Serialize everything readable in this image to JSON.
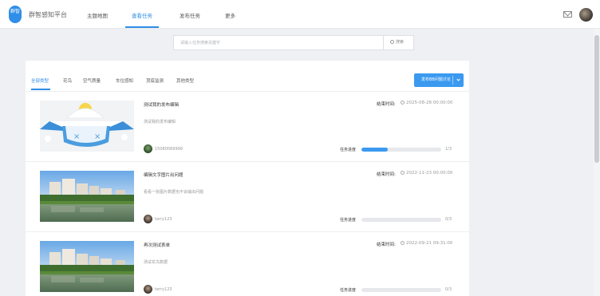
{
  "header": {
    "logo_text": "群智",
    "title": "群智感知平台",
    "nav": [
      {
        "label": "主题地图"
      },
      {
        "label": "查看任务"
      },
      {
        "label": "发布任务"
      },
      {
        "label": "更多"
      }
    ],
    "active_nav": "查看任务"
  },
  "search": {
    "placeholder": "请输入任务搜索关键字",
    "button_label": "搜索"
  },
  "tabs": {
    "items": [
      {
        "label": "全部类型"
      },
      {
        "label": "花鸟"
      },
      {
        "label": "空气质量"
      },
      {
        "label": "车位感知"
      },
      {
        "label": "顶底监测"
      },
      {
        "label": "其他类型"
      }
    ],
    "active": "全部类型"
  },
  "publish_button": {
    "label": "发布BB问题讨论"
  },
  "labels": {
    "end_time": "结束时间:",
    "progress": "任务进度"
  },
  "tasks": [
    {
      "title": "测试我的发布编辑",
      "desc": "测试我的发布编辑",
      "end_time": "2025-08-28 00:00:00",
      "user": "15080069999",
      "progress": 0.33,
      "progress_text": "1/3",
      "image": "error-placeholder"
    },
    {
      "title": "编辑文字图片出问题",
      "desc": "看看一张图片数据也不会输出问题",
      "end_time": "2022-11-23 00:00:00",
      "user": "terry123",
      "progress": 0,
      "progress_text": "0/3",
      "image": "campus-lake-photo"
    },
    {
      "title": "再次测试表单",
      "desc": "测试花鸟数据",
      "end_time": "2022-09-21 09:31:00",
      "user": "terry123",
      "progress": 0,
      "progress_text": "0/3",
      "image": "campus-lake-photo"
    }
  ],
  "colors": {
    "accent": "#2f8ee8",
    "button": "#3b9af0",
    "background": "#eef0f3"
  }
}
